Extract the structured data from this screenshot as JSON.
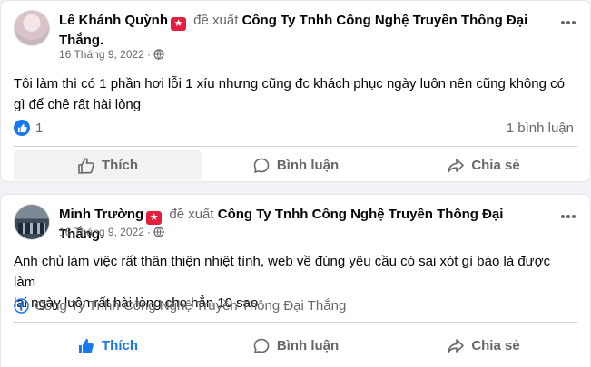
{
  "posts": [
    {
      "author": "Lê Khánh Quỳnh",
      "verb": "đề xuất",
      "company": "Công Ty Tnhh Công Nghệ Truyền Thông Đại",
      "company_cont": "Thắng.",
      "date": "16 Tháng 9, 2022",
      "separator": "·",
      "text_line1": "Tôi làm thì có 1 phần hơi lỗi 1 xíu nhưng cũng đc khách phục ngày luôn nên cũng không có",
      "text_line2": "gì để chê rất hài lòng",
      "reaction_count": "1",
      "comment_count": "1 bình luận",
      "actions": {
        "like": "Thích",
        "comment": "Bình luận",
        "share": "Chia sẻ"
      },
      "liked": false
    },
    {
      "author": "Minh Trường",
      "verb": "đề xuất",
      "company": "Công Ty Tnhh Công Nghệ Truyền Thông Đại Thắng.",
      "date": "16 Tháng 9, 2022",
      "separator": "·",
      "text_line1": "Anh chủ làm việc rất thân thiện nhiệt tình, web về đúng yêu cầu có sai xót gì báo là được làm",
      "text_line2": "lại ngày luôn rất hài lòng cho hẳn 10 sao",
      "page_link": "Công Ty Tnhh Công Nghệ Truyền Thông Đại Thắng",
      "actions": {
        "like": "Thích",
        "comment": "Bình luận",
        "share": "Chia sẻ"
      },
      "liked": true
    }
  ],
  "colors": {
    "accent": "#1877f2",
    "secondary_text": "#65676b",
    "badge": "#e41e3f"
  }
}
